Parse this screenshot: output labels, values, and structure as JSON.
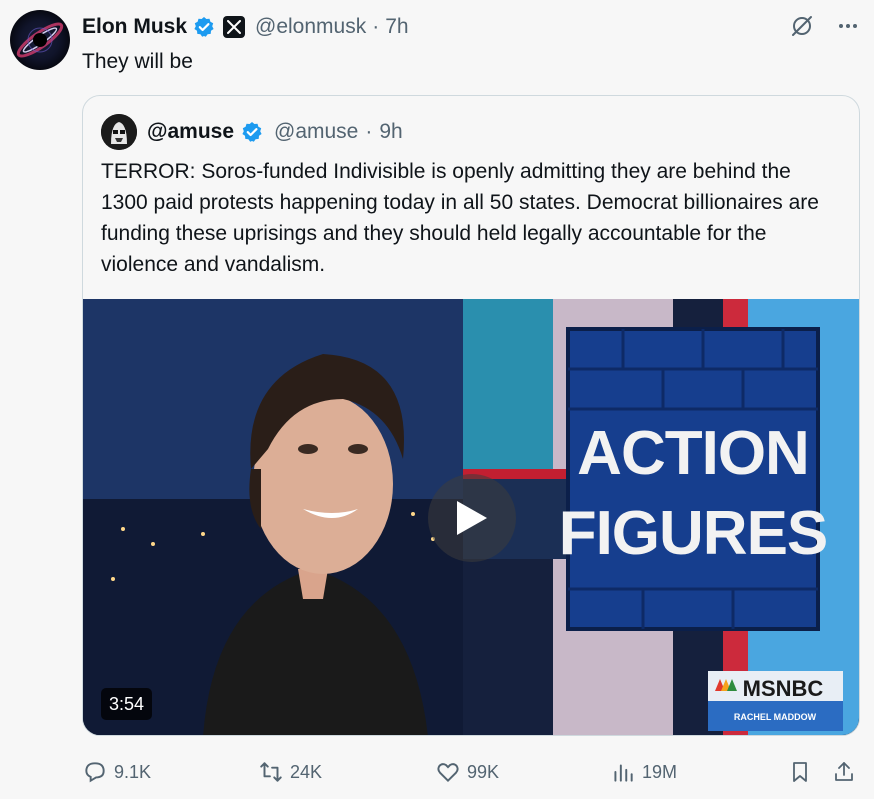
{
  "post": {
    "author_name": "Elon Musk",
    "author_handle": "@elonmusk",
    "separator": "·",
    "time": "7h",
    "text": "They will be"
  },
  "quote": {
    "author_name": "@amuse",
    "author_handle": "@amuse",
    "separator": "·",
    "time": "9h",
    "text": "TERROR: Soros-funded Indivisible is openly admitting they are behind the 1300 paid protests happening today in all 50 states. Democrat billionaires are funding these uprisings and they should held legally accountable for the violence and vandalism.",
    "video": {
      "duration": "3:54",
      "graphic_line1": "ACTION",
      "graphic_line2": "FIGURES",
      "network": "MSNBC",
      "show": "RACHEL MADDOW"
    }
  },
  "actions": {
    "replies": "9.1K",
    "reposts": "24K",
    "likes": "99K",
    "views": "19M"
  },
  "colors": {
    "verified": "#1d9bf0",
    "muted": "#536471",
    "border": "#cfd9de"
  },
  "icons": [
    "verified-badge-icon",
    "x-logo-icon",
    "grok-icon",
    "more-icon",
    "reply-icon",
    "repost-icon",
    "like-icon",
    "views-icon",
    "bookmark-icon",
    "share-icon",
    "play-icon"
  ]
}
